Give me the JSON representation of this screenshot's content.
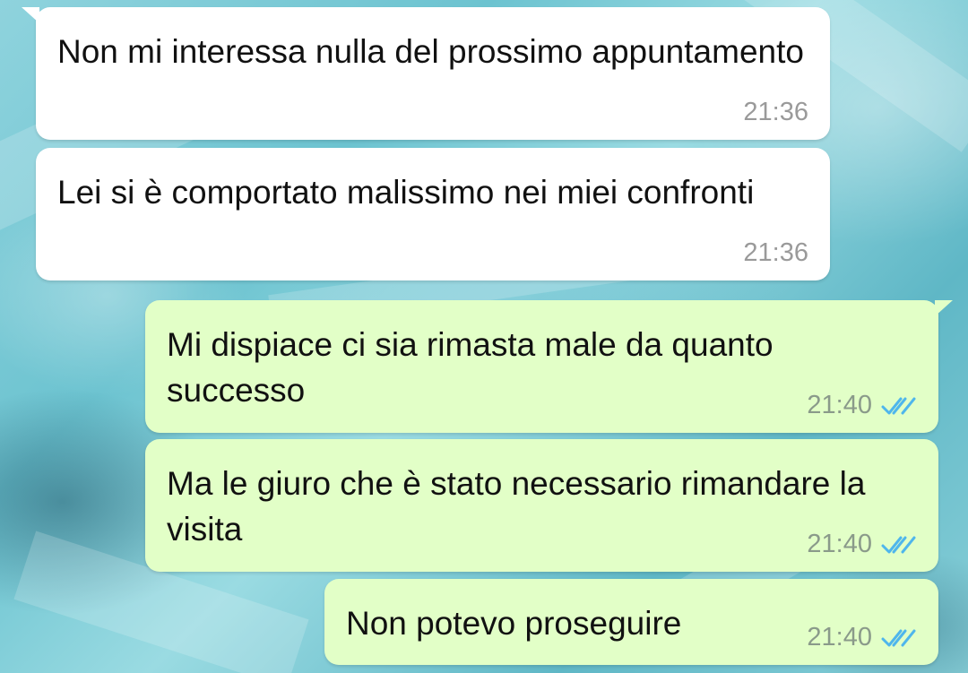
{
  "colors": {
    "incoming_bubble": "#ffffff",
    "outgoing_bubble": "#e2ffc7",
    "read_ticks": "#4fb6ec"
  },
  "messages": [
    {
      "direction": "incoming",
      "text": "Non mi interessa nulla del prossimo appuntamento",
      "time": "21:36"
    },
    {
      "direction": "incoming",
      "text": "Lei si è comportato malissimo nei miei confronti",
      "time": "21:36"
    },
    {
      "direction": "outgoing",
      "text": "Mi dispiace ci sia rimasta male da quanto successo",
      "time": "21:40",
      "status_icon": "double-check-read-icon"
    },
    {
      "direction": "outgoing",
      "text": "Ma le giuro che è stato necessario rimandare la visita",
      "time": "21:40",
      "status_icon": "double-check-read-icon"
    },
    {
      "direction": "outgoing",
      "text": "Non potevo proseguire",
      "time": "21:40",
      "status_icon": "double-check-read-icon"
    }
  ]
}
